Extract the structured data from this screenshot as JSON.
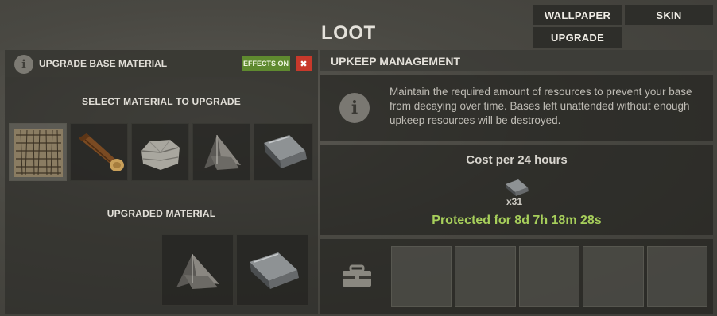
{
  "window": {
    "title": "LOOT"
  },
  "top_buttons": {
    "wallpaper": "WALLPAPER",
    "skin": "SKIN",
    "upgrade": "UPGRADE"
  },
  "left_panel": {
    "title": "UPGRADE BASE MATERIAL",
    "effects_label": "EFFECTS ON",
    "close_label": "✖",
    "select_label": "SELECT MATERIAL TO UPGRADE",
    "materials": [
      {
        "name": "twig-icon"
      },
      {
        "name": "wood-icon"
      },
      {
        "name": "stone-icon"
      },
      {
        "name": "metal-fragments-icon"
      },
      {
        "name": "hq-metal-icon"
      }
    ],
    "upgraded_label": "UPGRADED MATERIAL",
    "upgraded": [
      {
        "name": "metal-fragments-icon"
      },
      {
        "name": "hq-metal-icon"
      }
    ]
  },
  "right_panel": {
    "title": "UPKEEP MANAGEMENT",
    "description": "Maintain the required amount of resources to prevent your base from decaying over time. Bases left unattended without enough upkeep resources will be destroyed.",
    "cost_label": "Cost per 24 hours",
    "cost_item": "hq-metal-icon",
    "cost_quantity": "x31",
    "protected_text": "Protected for 8d 7h 18m 28s",
    "storage_slots": 5
  },
  "colors": {
    "accent_green": "#a7cf5b",
    "effects_green": "#5f8a2f",
    "close_red": "#c8392b"
  }
}
